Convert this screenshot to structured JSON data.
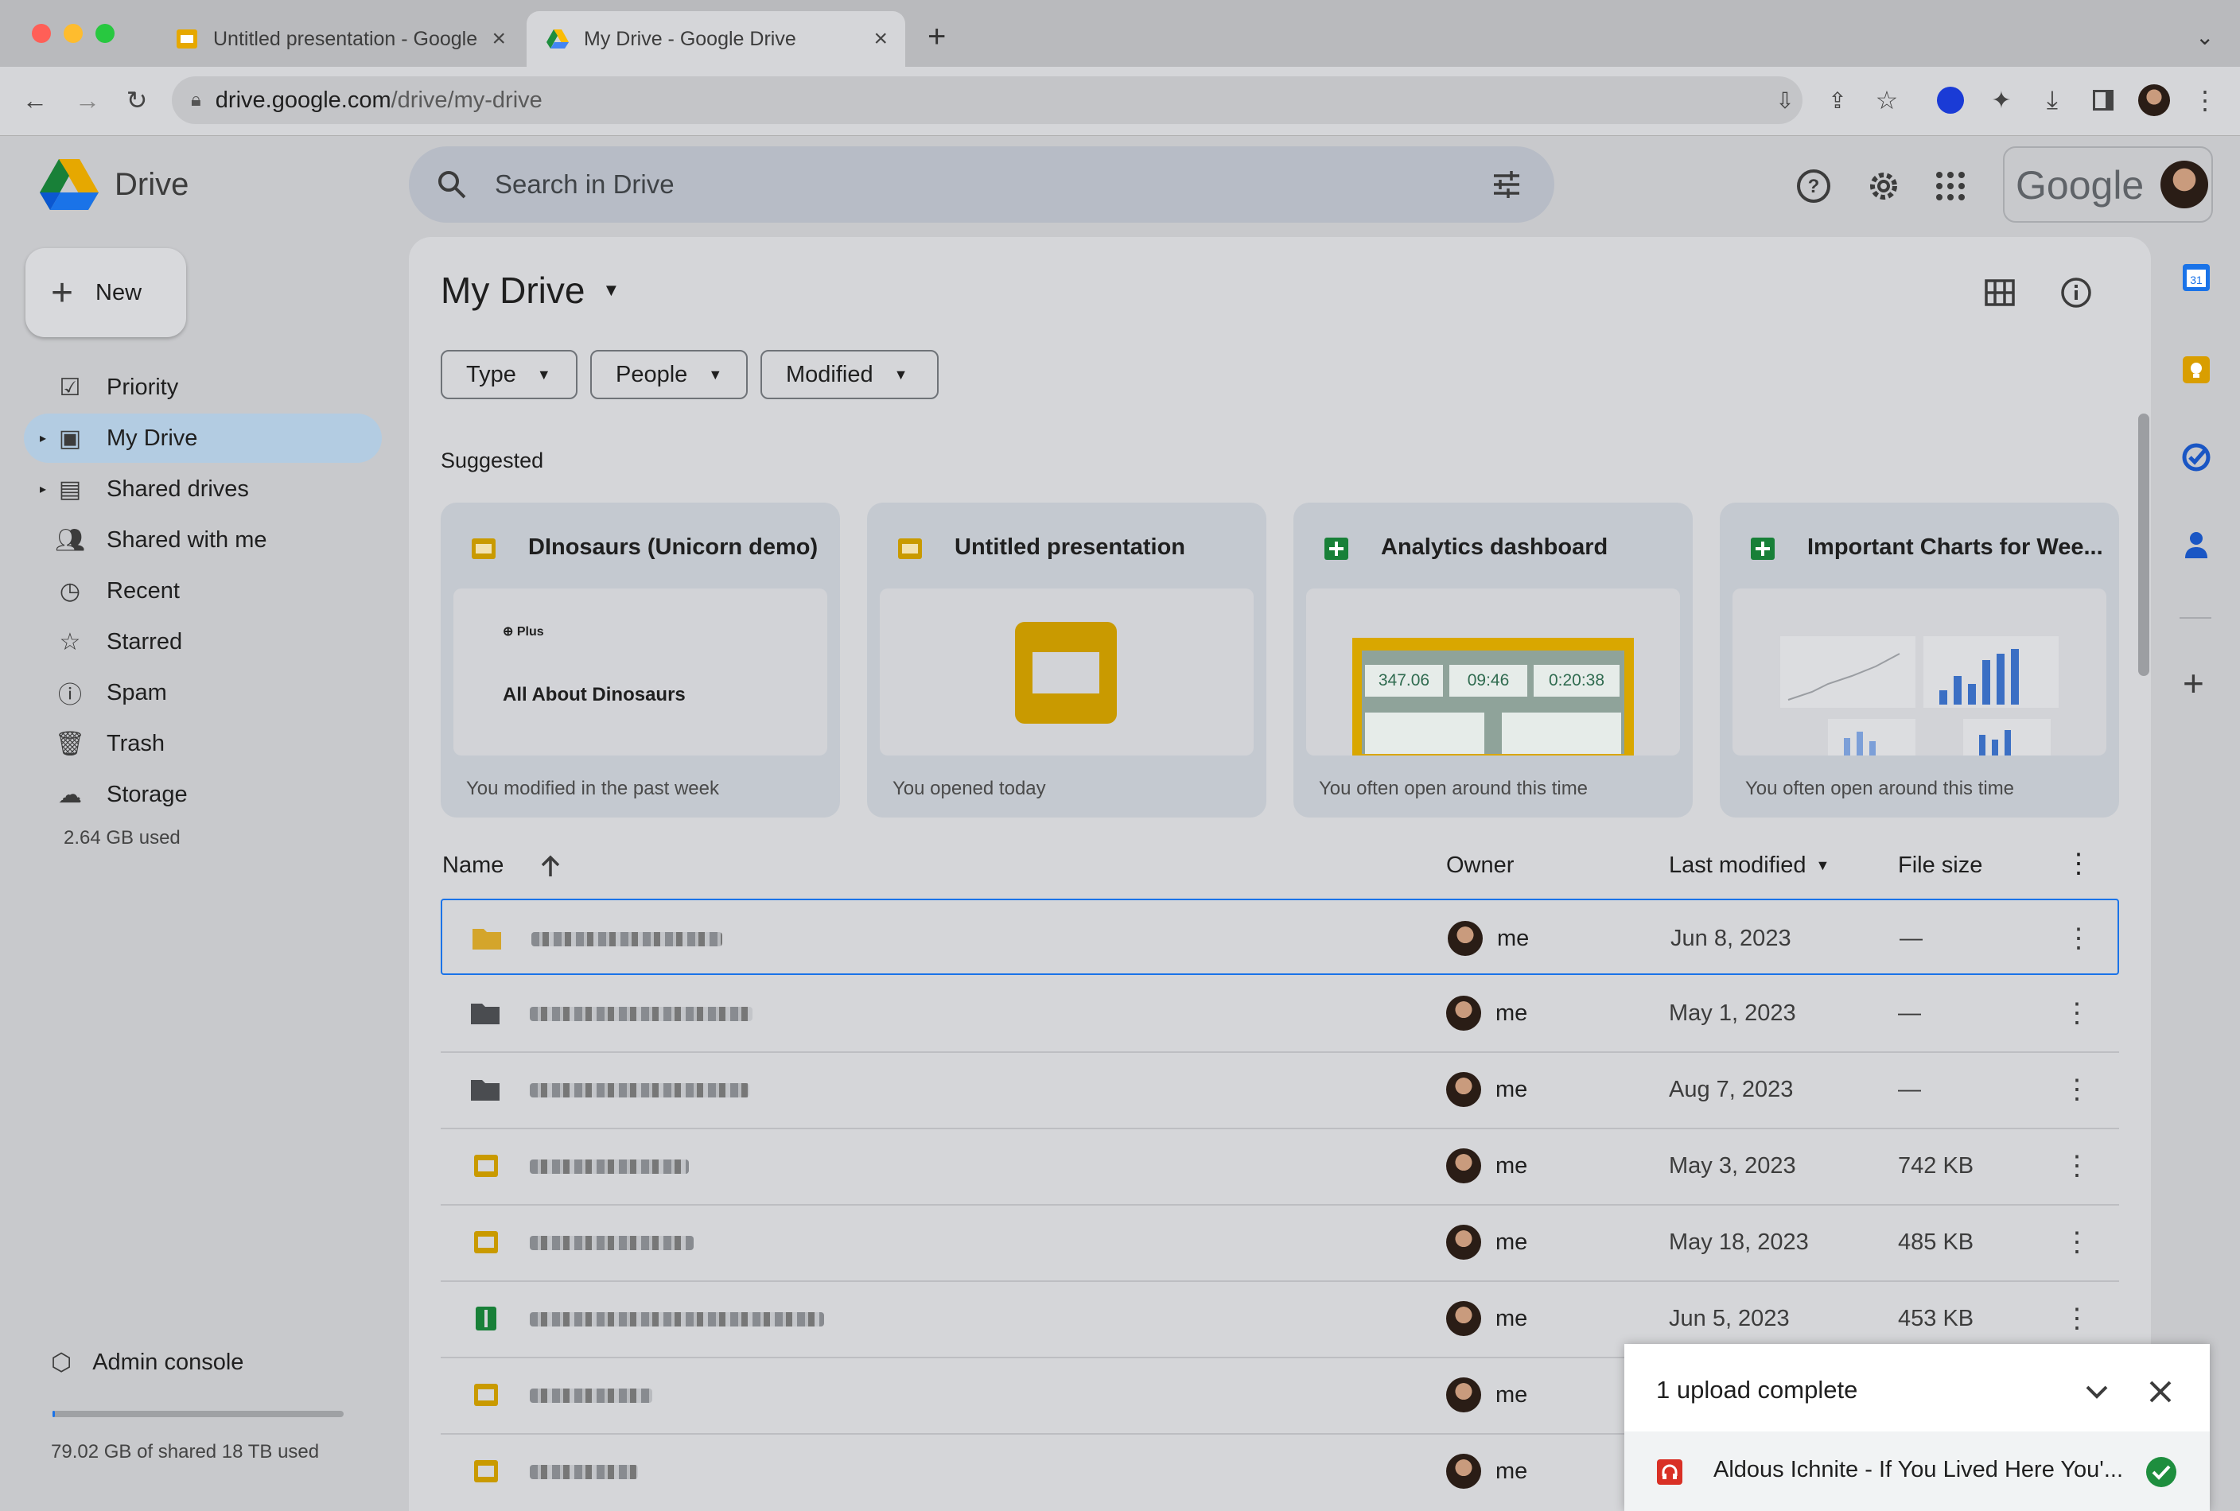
{
  "browser": {
    "tabs": [
      {
        "title": "Untitled presentation - Google",
        "icon": "slides-icon"
      },
      {
        "title": "My Drive - Google Drive",
        "icon": "drive-icon"
      }
    ],
    "url_domain": "drive.google.com",
    "url_path": "/drive/my-drive"
  },
  "header": {
    "product": "Drive",
    "search_placeholder": "Search in Drive",
    "google_label": "Google"
  },
  "sidebar": {
    "new_label": "New",
    "items": [
      {
        "label": "Priority",
        "icon": "priority-icon"
      },
      {
        "label": "My Drive",
        "icon": "my-drive-icon"
      },
      {
        "label": "Shared drives",
        "icon": "shared-drives-icon"
      },
      {
        "label": "Shared with me",
        "icon": "people-icon"
      },
      {
        "label": "Recent",
        "icon": "clock-icon"
      },
      {
        "label": "Starred",
        "icon": "star-icon"
      },
      {
        "label": "Spam",
        "icon": "spam-icon"
      },
      {
        "label": "Trash",
        "icon": "trash-icon"
      },
      {
        "label": "Storage",
        "icon": "cloud-icon"
      }
    ],
    "storage_used": "2.64 GB used",
    "admin_label": "Admin console",
    "shared_storage": "79.02 GB of shared 18 TB used",
    "shared_storage_fraction": 0.004
  },
  "main": {
    "title": "My Drive",
    "filters": [
      "Type",
      "People",
      "Modified"
    ],
    "suggested_label": "Suggested",
    "cards": [
      {
        "title": "DInosaurs (Unicorn demo)",
        "type": "slides",
        "footer": "You modified in the past week",
        "thumb_badge": "Plus",
        "thumb_text": "All About Dinosaurs"
      },
      {
        "title": "Untitled presentation",
        "type": "slides",
        "footer": "You opened today"
      },
      {
        "title": "Analytics dashboard",
        "type": "sheets",
        "footer": "You often open around this time",
        "thumb_values": [
          "347.06",
          "09:46",
          "0:20:38"
        ]
      },
      {
        "title": "Important Charts for Wee...",
        "type": "sheets",
        "footer": "You often open around this time"
      }
    ],
    "columns": {
      "name": "Name",
      "owner": "Owner",
      "modified": "Last modified",
      "size": "File size"
    },
    "rows": [
      {
        "type": "folder-shared",
        "owner": "me",
        "modified": "Jun 8, 2023",
        "size": "—"
      },
      {
        "type": "folder",
        "owner": "me",
        "modified": "May 1, 2023",
        "size": "—"
      },
      {
        "type": "folder",
        "owner": "me",
        "modified": "Aug 7, 2023",
        "size": "—"
      },
      {
        "type": "slides",
        "owner": "me",
        "modified": "May 3, 2023",
        "size": "742 KB"
      },
      {
        "type": "slides",
        "owner": "me",
        "modified": "May 18, 2023",
        "size": "485 KB"
      },
      {
        "type": "sheets",
        "owner": "me",
        "modified": "Jun 5, 2023",
        "size": "453 KB"
      },
      {
        "type": "slides",
        "owner": "me",
        "modified": "",
        "size": ""
      },
      {
        "type": "slides",
        "owner": "me",
        "modified": "",
        "size": ""
      }
    ]
  },
  "upload": {
    "title": "1 upload complete",
    "file": "Aldous Ichnite - If You Lived Here You'..."
  },
  "colors": {
    "accent": "#1a73e8",
    "selected_nav": "#b3cce2",
    "slides": "#c99a00",
    "sheets": "#188038",
    "success": "#1e8e3e"
  }
}
